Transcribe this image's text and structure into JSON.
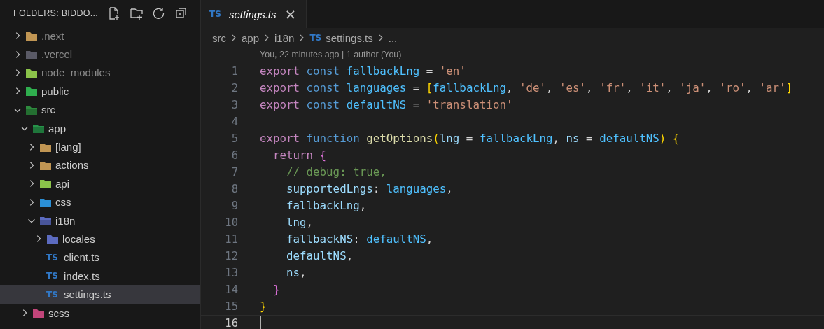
{
  "sidebar": {
    "title": "FOLDERS: BIDDO...",
    "tree": [
      {
        "label": ".next",
        "kind": "folder",
        "color": "#c09553",
        "dimmed": true,
        "expanded": false,
        "selected": false
      },
      {
        "label": ".vercel",
        "kind": "folder",
        "color": "#5a5a66",
        "dimmed": true,
        "expanded": false,
        "selected": false
      },
      {
        "label": "node_modules",
        "kind": "folder",
        "color": "#8bc34a",
        "dimmed": true,
        "expanded": false,
        "selected": false
      },
      {
        "label": "public",
        "kind": "folder",
        "color": "#2fae4e",
        "dimmed": false,
        "expanded": false,
        "selected": false
      },
      {
        "label": "src",
        "kind": "folder",
        "color": "#2e8b3e",
        "dimmed": false,
        "expanded": true,
        "selected": false,
        "children": [
          {
            "label": "app",
            "kind": "folder",
            "color": "#27944a",
            "dimmed": false,
            "expanded": true,
            "selected": false,
            "children": [
              {
                "label": "[lang]",
                "kind": "folder",
                "color": "#c09553",
                "dimmed": false,
                "expanded": false,
                "selected": false
              },
              {
                "label": "actions",
                "kind": "folder",
                "color": "#c09553",
                "dimmed": false,
                "expanded": false,
                "selected": false
              },
              {
                "label": "api",
                "kind": "folder",
                "color": "#8bc34a",
                "dimmed": false,
                "expanded": false,
                "selected": false
              },
              {
                "label": "css",
                "kind": "folder",
                "color": "#2b8fd6",
                "dimmed": false,
                "expanded": false,
                "selected": false
              },
              {
                "label": "i18n",
                "kind": "folder",
                "color": "#5c6bc0",
                "dimmed": false,
                "expanded": true,
                "selected": false,
                "children": [
                  {
                    "label": "locales",
                    "kind": "folder",
                    "color": "#5c6bc0",
                    "dimmed": false,
                    "expanded": false,
                    "selected": false
                  },
                  {
                    "label": "client.ts",
                    "kind": "ts-file",
                    "badge": "TS",
                    "dimmed": false,
                    "selected": false
                  },
                  {
                    "label": "index.ts",
                    "kind": "ts-file",
                    "badge": "TS",
                    "dimmed": false,
                    "selected": false
                  },
                  {
                    "label": "settings.ts",
                    "kind": "ts-file",
                    "badge": "TS",
                    "dimmed": false,
                    "selected": true
                  }
                ]
              }
            ]
          },
          {
            "label": "scss",
            "kind": "folder",
            "color": "#c2457a",
            "dimmed": false,
            "expanded": false,
            "selected": false
          }
        ]
      }
    ]
  },
  "tab": {
    "badge": "TS",
    "title": "settings.ts",
    "close": "×"
  },
  "breadcrumb": [
    {
      "label": "src",
      "kind": "text"
    },
    {
      "label": "app",
      "kind": "text"
    },
    {
      "label": "i18n",
      "kind": "text"
    },
    {
      "label": "settings.ts",
      "kind": "ts",
      "badge": "TS"
    },
    {
      "label": "...",
      "kind": "text"
    }
  ],
  "codelens": "You, 22 minutes ago | 1 author (You)",
  "lines": [
    {
      "number": "1",
      "current": false,
      "tokens": [
        {
          "text": "export ",
          "kind": "keyword"
        },
        {
          "text": "const ",
          "kind": "storage"
        },
        {
          "text": "fallbackLng",
          "kind": "constant"
        },
        {
          "text": " = ",
          "kind": "plain"
        },
        {
          "text": "'en'",
          "kind": "string"
        }
      ]
    },
    {
      "number": "2",
      "current": false,
      "tokens": [
        {
          "text": "export ",
          "kind": "keyword"
        },
        {
          "text": "const ",
          "kind": "storage"
        },
        {
          "text": "languages",
          "kind": "constant"
        },
        {
          "text": " = ",
          "kind": "plain"
        },
        {
          "text": "[",
          "kind": "bracket"
        },
        {
          "text": "fallbackLng",
          "kind": "constant"
        },
        {
          "text": ", ",
          "kind": "plain"
        },
        {
          "text": "'de'",
          "kind": "string"
        },
        {
          "text": ", ",
          "kind": "plain"
        },
        {
          "text": "'es'",
          "kind": "string"
        },
        {
          "text": ", ",
          "kind": "plain"
        },
        {
          "text": "'fr'",
          "kind": "string"
        },
        {
          "text": ", ",
          "kind": "plain"
        },
        {
          "text": "'it'",
          "kind": "string"
        },
        {
          "text": ", ",
          "kind": "plain"
        },
        {
          "text": "'ja'",
          "kind": "string"
        },
        {
          "text": ", ",
          "kind": "plain"
        },
        {
          "text": "'ro'",
          "kind": "string"
        },
        {
          "text": ", ",
          "kind": "plain"
        },
        {
          "text": "'ar'",
          "kind": "string"
        },
        {
          "text": "]",
          "kind": "bracket"
        }
      ]
    },
    {
      "number": "3",
      "current": false,
      "tokens": [
        {
          "text": "export ",
          "kind": "keyword"
        },
        {
          "text": "const ",
          "kind": "storage"
        },
        {
          "text": "defaultNS",
          "kind": "constant"
        },
        {
          "text": " = ",
          "kind": "plain"
        },
        {
          "text": "'translation'",
          "kind": "string"
        }
      ]
    },
    {
      "number": "4",
      "current": false
    },
    {
      "number": "5",
      "current": false,
      "tokens": [
        {
          "text": "export ",
          "kind": "keyword"
        },
        {
          "text": "function ",
          "kind": "storage"
        },
        {
          "text": "getOptions",
          "kind": "function"
        },
        {
          "text": "(",
          "kind": "bracket"
        },
        {
          "text": "lng",
          "kind": "variable"
        },
        {
          "text": " = ",
          "kind": "plain"
        },
        {
          "text": "fallbackLng",
          "kind": "constant"
        },
        {
          "text": ", ",
          "kind": "plain"
        },
        {
          "text": "ns",
          "kind": "variable"
        },
        {
          "text": " = ",
          "kind": "plain"
        },
        {
          "text": "defaultNS",
          "kind": "constant"
        },
        {
          "text": ")",
          "kind": "bracket"
        },
        {
          "text": " {",
          "kind": "bracket"
        }
      ]
    },
    {
      "number": "6",
      "current": false,
      "tokens": [
        {
          "text": "  return ",
          "kind": "keyword"
        },
        {
          "text": "{",
          "kind": "bracket2"
        }
      ]
    },
    {
      "number": "7",
      "current": false,
      "tokens": [
        {
          "text": "    // debug: true,",
          "kind": "comment"
        }
      ]
    },
    {
      "number": "8",
      "current": false,
      "tokens": [
        {
          "text": "    supportedLngs",
          "kind": "variable"
        },
        {
          "text": ": ",
          "kind": "plain"
        },
        {
          "text": "languages",
          "kind": "constant"
        },
        {
          "text": ",",
          "kind": "plain"
        }
      ]
    },
    {
      "number": "9",
      "current": false,
      "tokens": [
        {
          "text": "    fallbackLng",
          "kind": "variable"
        },
        {
          "text": ",",
          "kind": "plain"
        }
      ]
    },
    {
      "number": "10",
      "current": false,
      "tokens": [
        {
          "text": "    lng",
          "kind": "variable"
        },
        {
          "text": ",",
          "kind": "plain"
        }
      ]
    },
    {
      "number": "11",
      "current": false,
      "tokens": [
        {
          "text": "    fallbackNS",
          "kind": "variable"
        },
        {
          "text": ": ",
          "kind": "plain"
        },
        {
          "text": "defaultNS",
          "kind": "constant"
        },
        {
          "text": ",",
          "kind": "plain"
        }
      ]
    },
    {
      "number": "12",
      "current": false,
      "tokens": [
        {
          "text": "    defaultNS",
          "kind": "variable"
        },
        {
          "text": ",",
          "kind": "plain"
        }
      ]
    },
    {
      "number": "13",
      "current": false,
      "tokens": [
        {
          "text": "    ns",
          "kind": "variable"
        },
        {
          "text": ",",
          "kind": "plain"
        }
      ]
    },
    {
      "number": "14",
      "current": false,
      "tokens": [
        {
          "text": "  }",
          "kind": "bracket2"
        }
      ]
    },
    {
      "number": "15",
      "current": false,
      "tokens": [
        {
          "text": "}",
          "kind": "bracket"
        }
      ]
    },
    {
      "number": "16",
      "current": true
    }
  ]
}
